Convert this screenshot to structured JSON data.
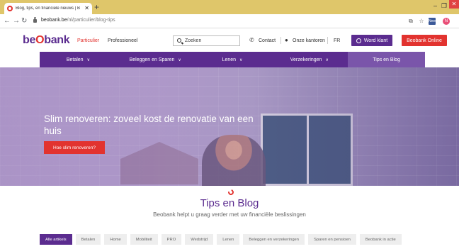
{
  "browser": {
    "tab_title": "Blog, tips, en financiele nieuws | B",
    "tab_close": "✕",
    "new_tab": "+",
    "url_host": "beobank.be",
    "url_path": "/nl/particulier/blog-tips",
    "window_controls": {
      "minimize": "–",
      "maximize": "❐",
      "close": "✕"
    },
    "profile_initial": "N",
    "folder_badge": "New"
  },
  "header": {
    "logo_pre": "be",
    "logo_o": "O",
    "logo_post": "bank",
    "nav_particulier": "Particulier",
    "nav_professioneel": "Professioneel",
    "search_placeholder": "Zoeken",
    "contact": "Contact",
    "kantoren": "Onze kantoren",
    "language": "FR",
    "word_klant": "Word klant",
    "online": "Beobank Online"
  },
  "mainnav": [
    {
      "label": "Betalen",
      "chevron": "∨"
    },
    {
      "label": "Beleggen en Sparen",
      "chevron": "∨"
    },
    {
      "label": "Lenen",
      "chevron": "∨"
    },
    {
      "label": "Verzekeringen",
      "chevron": "∨"
    },
    {
      "label": "Tips en Blog",
      "chevron": ""
    }
  ],
  "hero": {
    "title": "Slim renoveren: zoveel kost de renovatie van een huis",
    "button": "Hoe slim renoveren?"
  },
  "blog": {
    "title": "Tips en Blog",
    "subtitle": "Beobank helpt u graag verder met uw financiële beslissingen"
  },
  "filters": [
    "Alle artikels",
    "Betalen",
    "Home",
    "Mobiliteit",
    "PRO",
    "Wedstrijd",
    "Lenen",
    "Beleggen en verzekeringen",
    "Sparen en pensioen",
    "Beobank in actie"
  ],
  "colors": {
    "brand_purple": "#5b2c8f",
    "brand_red": "#e2332f",
    "chrome_tabbar": "#dfc66a"
  }
}
